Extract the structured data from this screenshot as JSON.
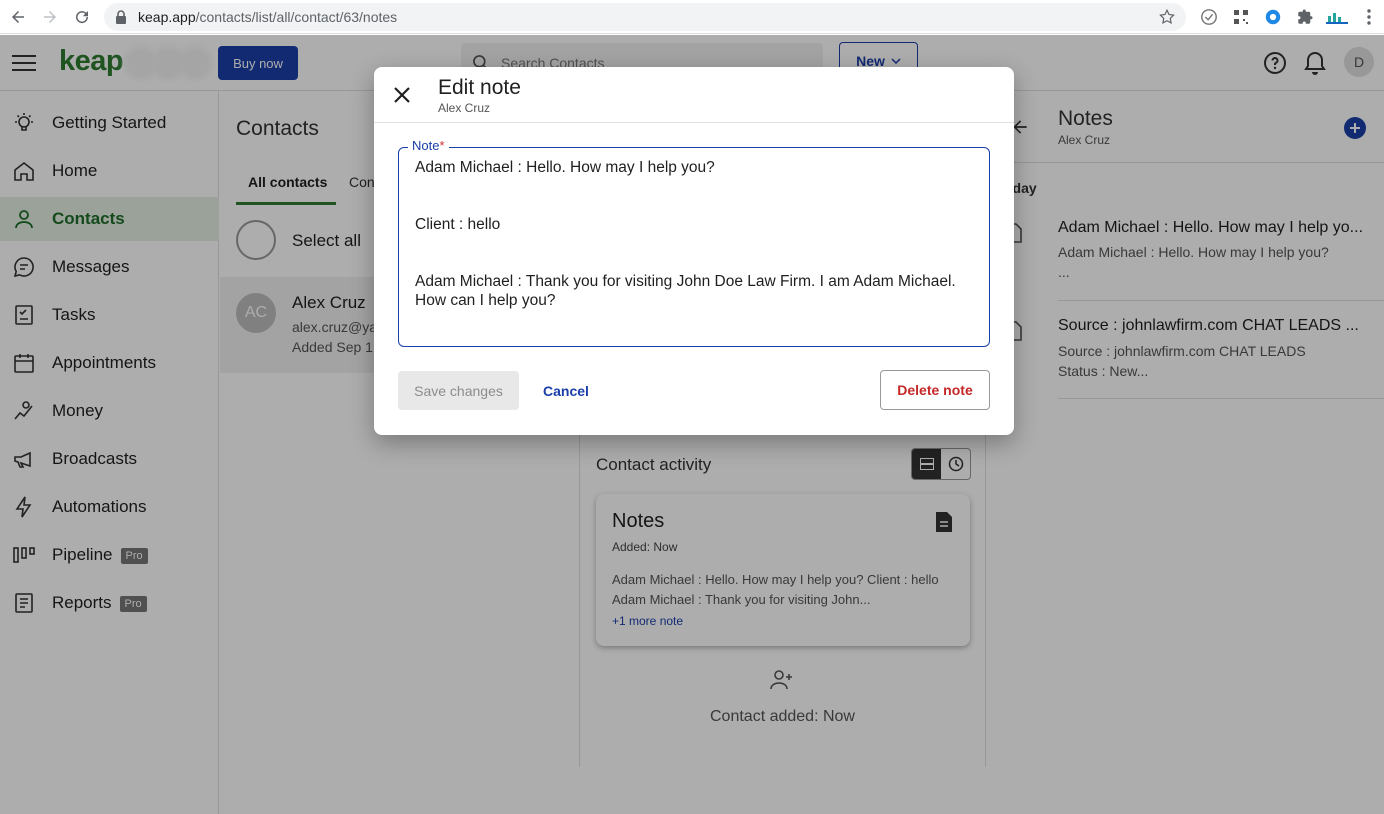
{
  "browser": {
    "url_domain": "keap.app",
    "url_path": "/contacts/list/all/contact/63/notes"
  },
  "app": {
    "logo": "keap",
    "buy_now": "Buy now",
    "search_placeholder": "Search Contacts",
    "new_label": "New",
    "user_initial": "D"
  },
  "sidebar": {
    "items": [
      {
        "label": "Getting Started",
        "icon": "lightbulb-icon"
      },
      {
        "label": "Home",
        "icon": "home-icon"
      },
      {
        "label": "Contacts",
        "icon": "person-icon",
        "active": true
      },
      {
        "label": "Messages",
        "icon": "chat-icon"
      },
      {
        "label": "Tasks",
        "icon": "checklist-icon"
      },
      {
        "label": "Appointments",
        "icon": "calendar-icon"
      },
      {
        "label": "Money",
        "icon": "money-icon"
      },
      {
        "label": "Broadcasts",
        "icon": "megaphone-icon"
      },
      {
        "label": "Automations",
        "icon": "lightning-icon"
      },
      {
        "label": "Pipeline",
        "icon": "pipeline-icon",
        "badge": "Pro"
      },
      {
        "label": "Reports",
        "icon": "report-icon",
        "badge": "Pro"
      }
    ]
  },
  "contacts": {
    "title": "Contacts",
    "tab_all": "All contacts",
    "tab_other": "Con",
    "select_all": "Select all",
    "row": {
      "initials": "AC",
      "name": "Alex Cruz",
      "email": "alex.cruz@ya",
      "added": "Added Sep 1"
    }
  },
  "detail": {
    "activity_title": "Contact activity",
    "card": {
      "title": "Notes",
      "added": "Added: Now",
      "body": "Adam Michael : Hello. How may I help you? Client : hello Adam Michael : Thank you for visiting John...",
      "more": "+1 more note"
    },
    "contact_added": "Contact added: Now"
  },
  "notes_panel": {
    "title": "Notes",
    "subtitle": "Alex Cruz",
    "group": "oday",
    "items": [
      {
        "title": "Adam Michael : Hello. How may I help yo...",
        "line1": "Adam Michael : Hello. How may I help you?",
        "line2": "..."
      },
      {
        "title": "Source : johnlawfirm.com CHAT LEADS ...",
        "line1": "Source : johnlawfirm.com CHAT LEADS",
        "line2": "Status : New..."
      }
    ]
  },
  "modal": {
    "title": "Edit note",
    "subtitle": "Alex Cruz",
    "field_label": "Note",
    "required_mark": "*",
    "lines": [
      "Adam Michael : Hello. How may I help you?",
      "Client : hello",
      "Adam Michael : Thank you for visiting John Doe Law Firm. I am Adam Michael. How can I help you?"
    ],
    "save_label": "Save changes",
    "cancel_label": "Cancel",
    "delete_label": "Delete note"
  },
  "colors": {
    "brand_green": "#2e7d32",
    "primary_blue": "#1a3fa8",
    "danger_red": "#c62828"
  }
}
